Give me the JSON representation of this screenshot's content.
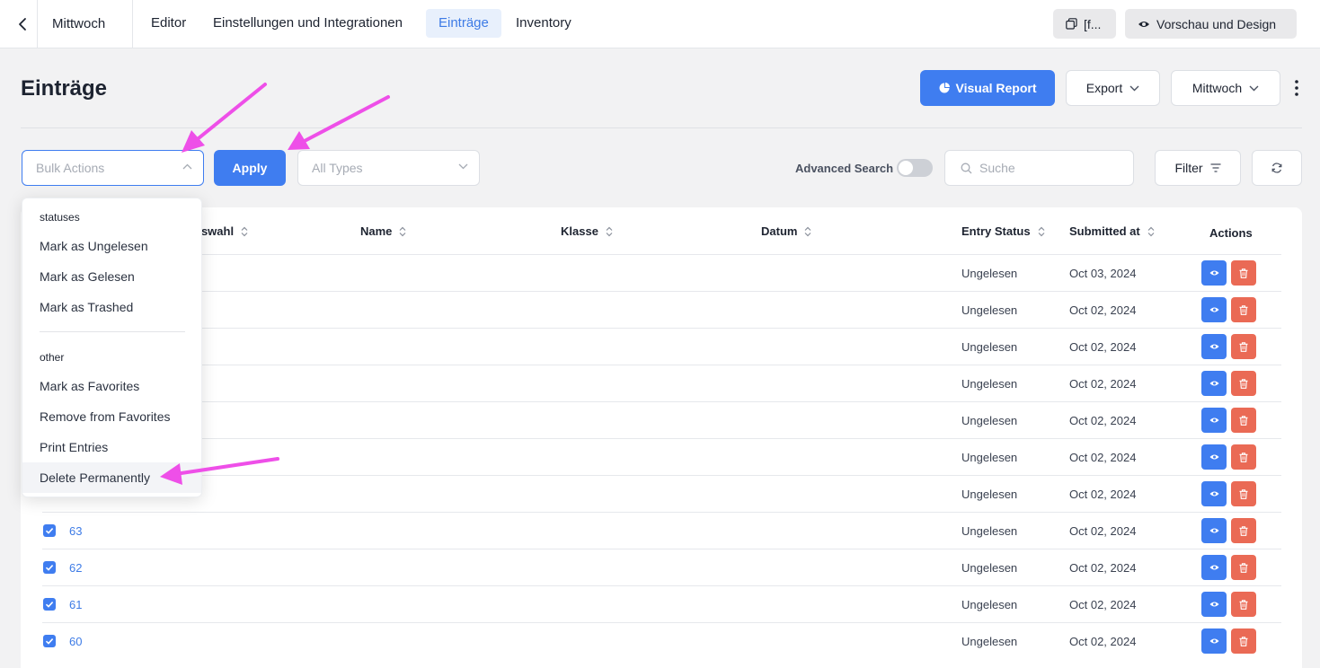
{
  "nav": {
    "form_name": "Mittwoch",
    "tabs": [
      {
        "label": "Editor"
      },
      {
        "label": "Einstellungen und Integrationen"
      },
      {
        "label": "Einträge"
      },
      {
        "label": "Inventory"
      }
    ],
    "shortcode_label": "[f...",
    "preview_label": "Vorschau und Design"
  },
  "header": {
    "title": "Einträge",
    "visual_report_label": "Visual Report",
    "export_label": "Export",
    "form_select_label": "Mittwoch"
  },
  "filters": {
    "bulk_actions_placeholder": "Bulk Actions",
    "apply_label": "Apply",
    "types_placeholder": "All Types",
    "advanced_search_label": "Advanced Search",
    "search_placeholder": "Suche",
    "filter_label": "Filter"
  },
  "table": {
    "columns": [
      {
        "label": "uswahl"
      },
      {
        "label": "Name"
      },
      {
        "label": "Klasse"
      },
      {
        "label": "Datum"
      },
      {
        "label": "Entry Status"
      },
      {
        "label": "Submitted at"
      },
      {
        "label": "Actions"
      }
    ],
    "rows": [
      {
        "id": "",
        "status": "Ungelesen",
        "submitted": "Oct 03, 2024"
      },
      {
        "id": "",
        "status": "Ungelesen",
        "submitted": "Oct 02, 2024"
      },
      {
        "id": "",
        "status": "Ungelesen",
        "submitted": "Oct 02, 2024"
      },
      {
        "id": "",
        "status": "Ungelesen",
        "submitted": "Oct 02, 2024"
      },
      {
        "id": "",
        "status": "Ungelesen",
        "submitted": "Oct 02, 2024"
      },
      {
        "id": "",
        "status": "Ungelesen",
        "submitted": "Oct 02, 2024"
      },
      {
        "id": "",
        "status": "Ungelesen",
        "submitted": "Oct 02, 2024"
      },
      {
        "id": "63",
        "status": "Ungelesen",
        "submitted": "Oct 02, 2024"
      },
      {
        "id": "62",
        "status": "Ungelesen",
        "submitted": "Oct 02, 2024"
      },
      {
        "id": "61",
        "status": "Ungelesen",
        "submitted": "Oct 02, 2024"
      },
      {
        "id": "60",
        "status": "Ungelesen",
        "submitted": "Oct 02, 2024"
      }
    ]
  },
  "bulk_dropdown": {
    "groups": [
      {
        "label": "statuses",
        "items": [
          "Mark as Ungelesen",
          "Mark as Gelesen",
          "Mark as Trashed"
        ]
      },
      {
        "label": "other",
        "items": [
          "Mark as Favorites",
          "Remove from Favorites",
          "Print Entries",
          "Delete Permanently"
        ]
      }
    ]
  },
  "colors": {
    "primary": "#3f7df0",
    "danger": "#ea6a55",
    "annotation_arrow": "#ee4fe8"
  },
  "icons": {
    "back": "chevron-left-icon",
    "shortcode": "copy-icon",
    "preview": "eye-icon",
    "visual_report": "pie-chart-icon",
    "view": "eye-icon",
    "delete": "trash-icon",
    "refresh": "refresh-icon",
    "filter": "filter-lines-icon",
    "search": "search-icon",
    "more": "kebab-icon"
  }
}
